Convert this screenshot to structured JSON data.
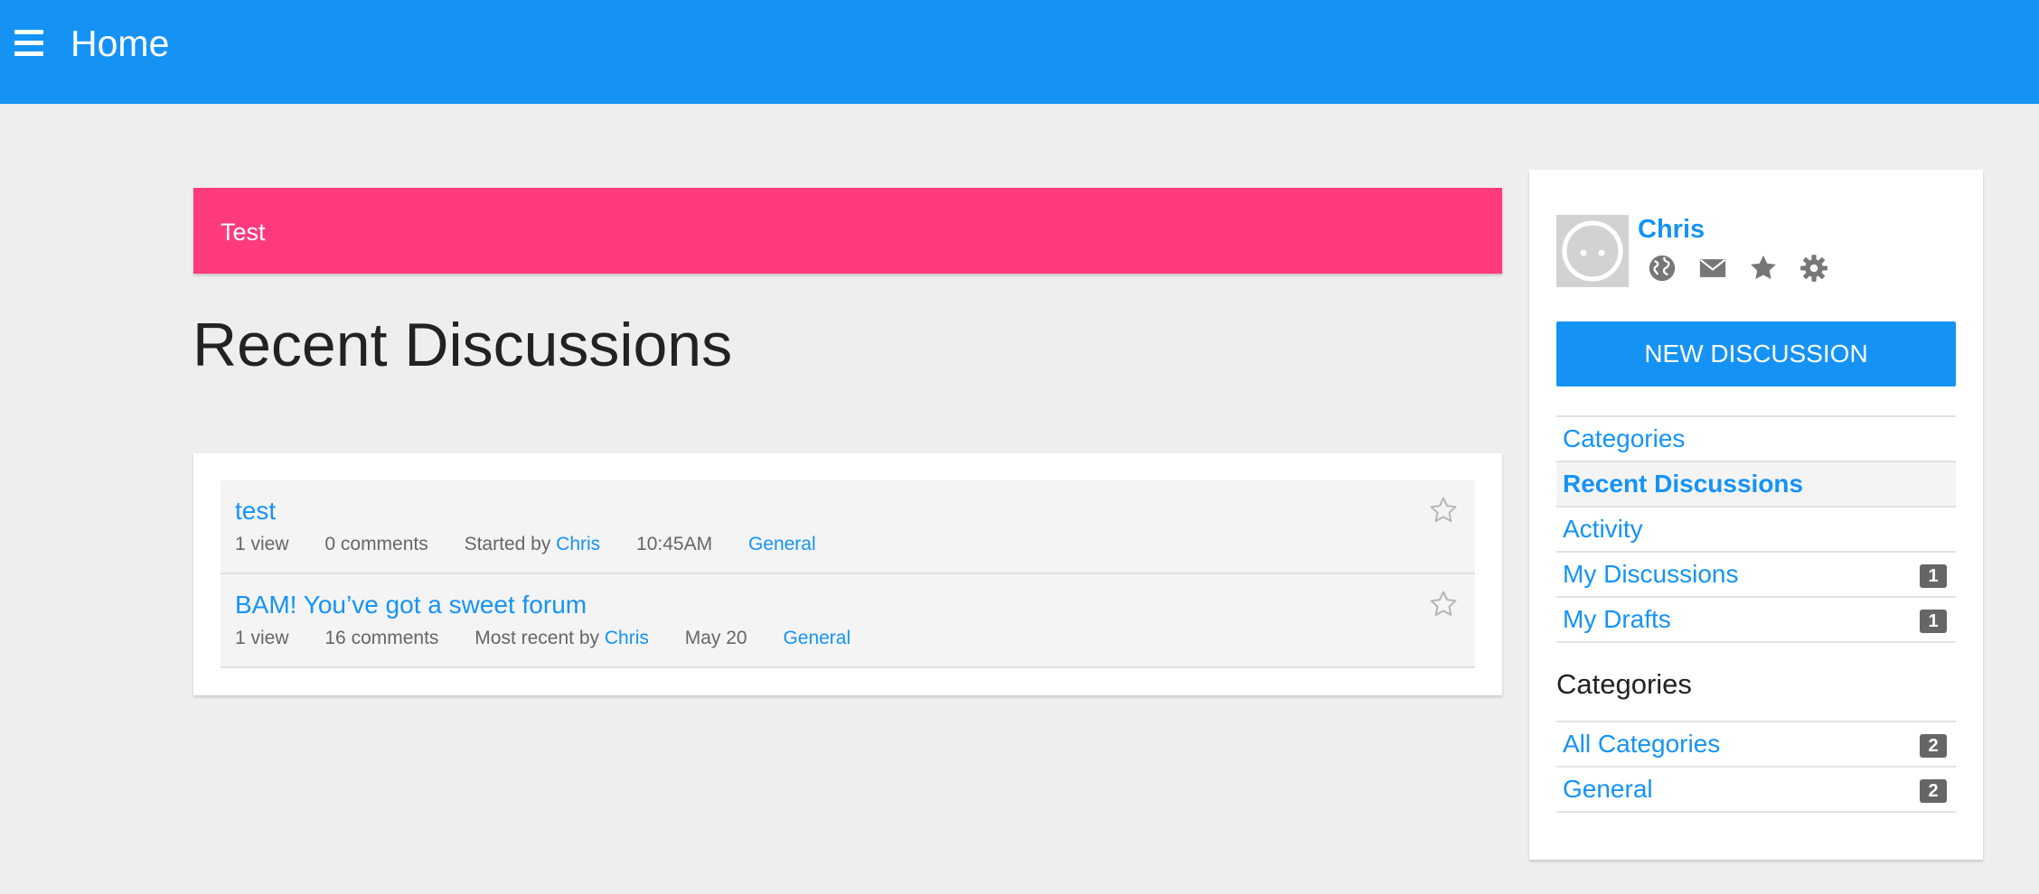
{
  "header": {
    "menu_icon": "hamburger-menu-icon",
    "title": "Home"
  },
  "banner": {
    "text": "Test"
  },
  "main": {
    "heading": "Recent Discussions",
    "discussions": [
      {
        "title": "test",
        "views": "1 view",
        "comments": "0 comments",
        "by_label": "Started by",
        "author": "Chris",
        "time": "10:45AM",
        "category": "General"
      },
      {
        "title": "BAM! You’ve got a sweet forum",
        "views": "1 view",
        "comments": "16 comments",
        "by_label": "Most recent by",
        "author": "Chris",
        "time": "May 20",
        "category": "General"
      }
    ]
  },
  "sidebar": {
    "user": {
      "name": "Chris",
      "icons": [
        "globe-icon",
        "mail-icon",
        "star-icon",
        "gear-icon"
      ]
    },
    "new_discussion_label": "NEW DISCUSSION",
    "nav": [
      {
        "label": "Categories",
        "count": ""
      },
      {
        "label": "Recent Discussions",
        "count": "",
        "active": true
      },
      {
        "label": "Activity",
        "count": ""
      },
      {
        "label": "My Discussions",
        "count": "1"
      },
      {
        "label": "My Drafts",
        "count": "1"
      }
    ],
    "categories_heading": "Categories",
    "categories": [
      {
        "label": "All Categories",
        "count": "2"
      },
      {
        "label": "General",
        "count": "2"
      }
    ]
  },
  "colors": {
    "header_bg": "#1593f5",
    "banner_bg": "#ff3b7e",
    "link": "#1593f5",
    "page_bg": "#eeeeee",
    "badge_bg": "#666666"
  }
}
